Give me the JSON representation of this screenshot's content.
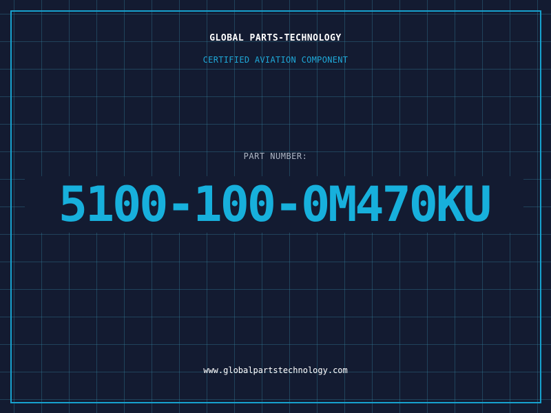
{
  "header": {
    "brand": "GLOBAL PARTS-TECHNOLOGY",
    "subtitle": "CERTIFIED AVIATION COMPONENT"
  },
  "part": {
    "label": "PART NUMBER:",
    "number": "5100-100-0M470KU"
  },
  "footer": {
    "url": "www.globalpartstechnology.com"
  },
  "colors": {
    "background": "#131b31",
    "grid": "#388caa",
    "accent": "#17b0dc",
    "text": "#ffffff",
    "muted": "#aeb6c4"
  }
}
